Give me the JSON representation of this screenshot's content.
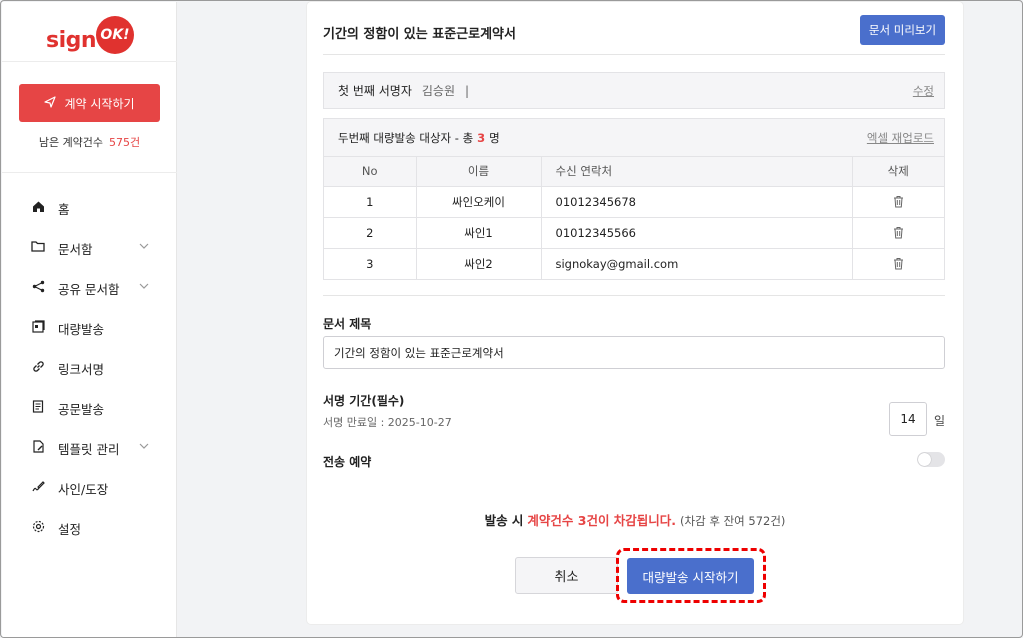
{
  "brand": {
    "text": "sign",
    "badge": "OK!"
  },
  "sidebar": {
    "start_button": "계약 시작하기",
    "remaining_label": "남은 계약건수",
    "remaining_count": "575건",
    "items": [
      {
        "label": "홈",
        "icon": "home-icon",
        "has_children": false
      },
      {
        "label": "문서함",
        "icon": "folder-icon",
        "has_children": true
      },
      {
        "label": "공유 문서함",
        "icon": "share-icon",
        "has_children": true
      },
      {
        "label": "대량발송",
        "icon": "bulk-send-icon",
        "has_children": false
      },
      {
        "label": "링크서명",
        "icon": "link-icon",
        "has_children": false
      },
      {
        "label": "공문발송",
        "icon": "document-icon",
        "has_children": false
      },
      {
        "label": "템플릿 관리",
        "icon": "template-icon",
        "has_children": true
      },
      {
        "label": "사인/도장",
        "icon": "signature-icon",
        "has_children": false
      },
      {
        "label": "설정",
        "icon": "gear-icon",
        "has_children": false
      }
    ]
  },
  "main": {
    "doc_title": "기간의 정함이 있는 표준근로계약서",
    "preview_button": "문서 미리보기",
    "first_signer": {
      "label": "첫 번째 서명자",
      "name": "김승원",
      "separator": "|",
      "edit": "수정"
    },
    "bulk": {
      "title_prefix": "두번째 대량발송 대상자 - 총",
      "count": "3",
      "title_suffix": "명",
      "excel_reupload": "엑셀 재업로드",
      "columns": [
        "No",
        "이름",
        "수신 연락처",
        "삭제"
      ],
      "rows": [
        {
          "no": "1",
          "name": "싸인오케이",
          "contact": "01012345678"
        },
        {
          "no": "2",
          "name": "싸인1",
          "contact": "01012345566"
        },
        {
          "no": "3",
          "name": "싸인2",
          "contact": "signokay@gmail.com"
        }
      ]
    },
    "doc_name_label": "문서 제목",
    "doc_name_value": "기간의 정함이 있는 표준근로계약서",
    "sign_period_label": "서명 기간(필수)",
    "sign_expiry": "서명 만료일 : 2025-10-27",
    "days_value": "14",
    "days_unit": "일",
    "schedule_label": "전송 예약",
    "schedule_enabled": false,
    "notice_prefix": "발송 시",
    "notice_red": "계약건수 3건이 차감됩니다.",
    "notice_suffix": "(차감 후 잔여 572건)",
    "cancel_button": "취소",
    "send_button": "대량발송 시작하기"
  },
  "colors": {
    "accent_red": "#e64545",
    "primary_blue": "#4a6fcc",
    "highlight": "#e00000"
  }
}
